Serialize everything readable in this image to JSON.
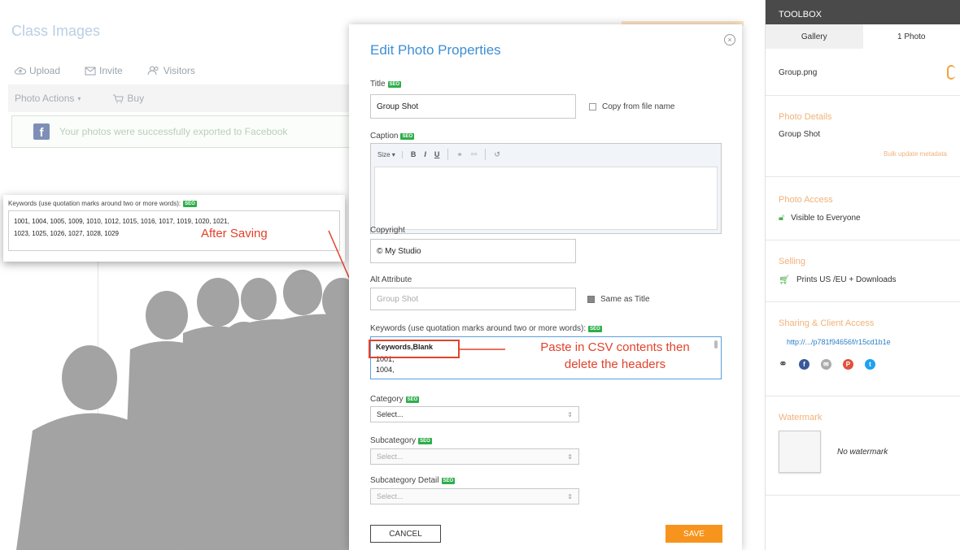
{
  "background": {
    "title": "Class Images",
    "nav": [
      {
        "icon": "upload-icon",
        "label": "Upload"
      },
      {
        "icon": "invite-icon",
        "label": "Invite"
      },
      {
        "icon": "visitors-icon",
        "label": "Visitors"
      }
    ],
    "photo_actions_label": "Photo Actions",
    "buy_label": "Buy",
    "facebook_notice": "Your photos were successfully exported to Facebook"
  },
  "saved_keywords": {
    "label": "Keywords (use quotation marks around two or more words):",
    "seo_badge": "SEO",
    "line1": "1001, 1004, 1005, 1009, 1010, 1012, 1015, 1016, 1017, 1019, 1020, 1021,",
    "line2": "1023, 1025, 1026, 1027, 1028, 1029",
    "annotation": "After Saving"
  },
  "dialog": {
    "title": "Edit Photo Properties",
    "close_icon": "×",
    "seo_badge": "SEO",
    "title_label": "Title",
    "title_value": "Group Shot",
    "copy_from_file_label": "Copy from file name",
    "caption_label": "Caption",
    "caption_toolbar": {
      "size": "Size",
      "bold": "B",
      "italic": "I",
      "underline": "U"
    },
    "copyright_label": "Copyright",
    "copyright_value": "© My Studio",
    "alt_label": "Alt Attribute",
    "alt_value": "Group Shot",
    "same_as_title_label": "Same as Title",
    "keywords_label": "Keywords (use quotation marks around two or more words):",
    "keywords_lines": [
      "Keywords,Blank",
      "1001,",
      "1004,"
    ],
    "paste_annotation_1": "Paste in CSV contents then",
    "paste_annotation_2": "delete the headers",
    "category_label": "Category",
    "category_value": "Select...",
    "subcategory_label": "Subcategory",
    "subcategory_value": "Select...",
    "subcategory_detail_label": "Subcategory Detail",
    "subcategory_detail_value": "Select...",
    "cancel_label": "CANCEL",
    "save_label": "SAVE"
  },
  "toolbox": {
    "header": "TOOLBOX",
    "tabs": [
      "Gallery",
      "1 Photo"
    ],
    "filename": "Group.png",
    "photo_details_title": "Photo Details",
    "photo_details_value": "Group Shot",
    "bulk_update_label": "Bulk update metadata",
    "photo_access_title": "Photo Access",
    "photo_access_value": "Visible to Everyone",
    "selling_title": "Selling",
    "selling_value": "Prints US /EU + Downloads",
    "sharing_title": "Sharing & Client Access",
    "sharing_link": "http://.../p781f94656f/r15cd1b1e",
    "watermark_title": "Watermark",
    "watermark_value": "No watermark"
  },
  "colors": {
    "accent_blue": "#3d8ed4",
    "save_orange": "#f7941d",
    "annotation_red": "#e2422b",
    "section_title_orange": "#f2b179",
    "seo_green": "#2eae4a"
  }
}
